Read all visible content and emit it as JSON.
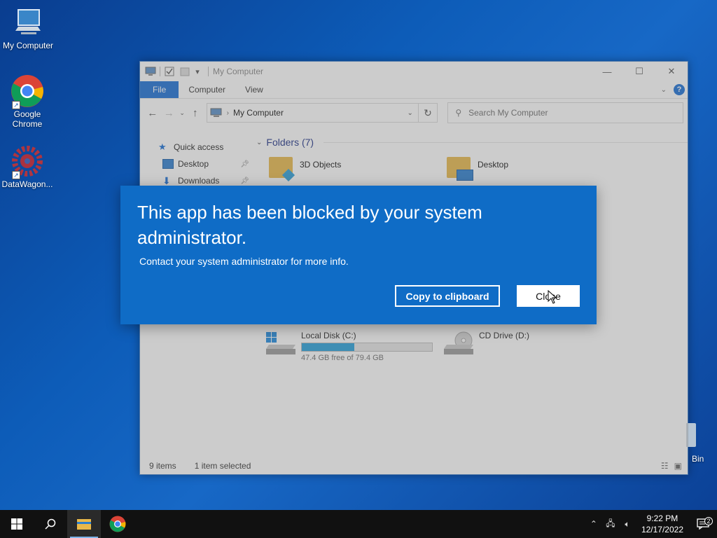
{
  "desktop": {
    "icons": [
      {
        "label": "My Computer"
      },
      {
        "label": "Google Chrome"
      },
      {
        "label": "DataWagon..."
      }
    ],
    "recycle_bin_label": "Bin"
  },
  "explorer": {
    "title": "My Computer",
    "tabs": [
      "File",
      "Computer",
      "View"
    ],
    "address": "My Computer",
    "search_placeholder": "Search My Computer",
    "nav": [
      {
        "label": "Quick access"
      },
      {
        "label": "Desktop"
      },
      {
        "label": "Downloads"
      }
    ],
    "folders_header": "Folders (7)",
    "folders": [
      {
        "label": "3D Objects"
      },
      {
        "label": "Desktop"
      }
    ],
    "drives": [
      {
        "label": "Local Disk (C:)",
        "free": "47.4 GB free of 79.4 GB",
        "used_fraction": 0.403
      },
      {
        "label": "CD Drive (D:)"
      }
    ],
    "status": {
      "items": "9 items",
      "selected": "1 item selected"
    }
  },
  "dialog": {
    "title": "This app has been blocked by your system administrator.",
    "message": "Contact your system administrator for more info.",
    "copy_button": "Copy to clipboard",
    "close_button": "Close"
  },
  "taskbar": {
    "time": "9:22 PM",
    "date": "12/17/2022",
    "notification_count": "2"
  },
  "colors": {
    "accent": "#0f6cc6",
    "ribbon_file": "#1a6fd6",
    "drive_bar": "#26a0da"
  }
}
